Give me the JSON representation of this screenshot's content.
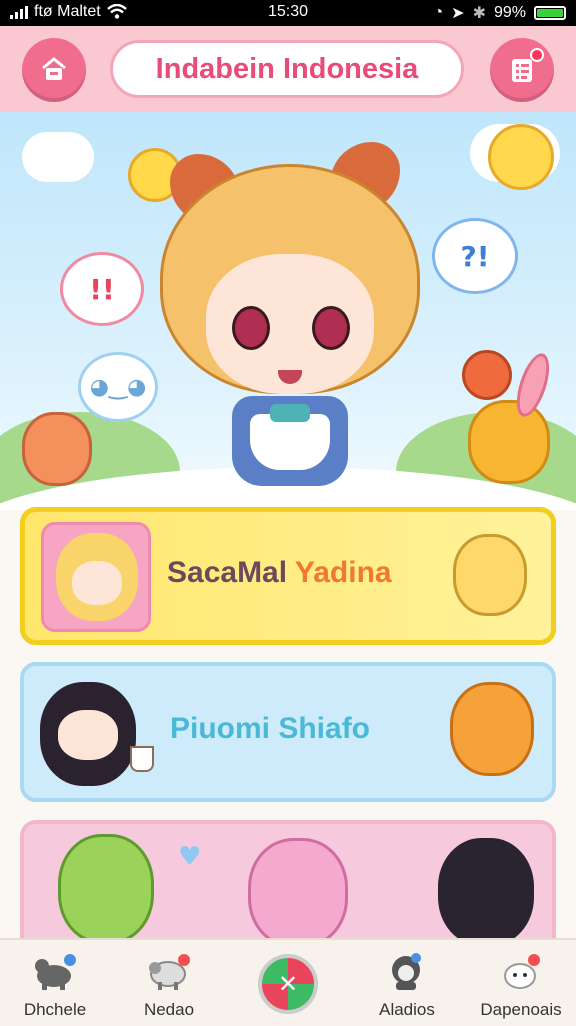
{
  "status_bar": {
    "carrier": "ftø Maltet",
    "time": "15:30",
    "battery": "99%",
    "battery_level": 0.99
  },
  "header": {
    "title": "Indabein Indonesia",
    "left_icon": "home-icon",
    "right_icon": "notes-icon"
  },
  "hero": {
    "bubble_left": "!!",
    "bubble_right": "?!"
  },
  "cards": [
    {
      "label_a": "SacaMal ",
      "label_b": "Yadina",
      "color_a": "#6b4a5a",
      "color_b": "#f0782f"
    },
    {
      "label": "Piuomi Shiafo",
      "color": "#49b9d6"
    },
    {
      "label": ""
    }
  ],
  "bottom_nav": [
    {
      "label": "Dhchele",
      "icon": "animal-icon"
    },
    {
      "label": "Nedao",
      "icon": "sheep-icon"
    },
    {
      "label": "",
      "icon": "center-action-icon"
    },
    {
      "label": "Aladios",
      "icon": "character-icon"
    },
    {
      "label": "Dapenoais",
      "icon": "bunny-icon"
    }
  ]
}
